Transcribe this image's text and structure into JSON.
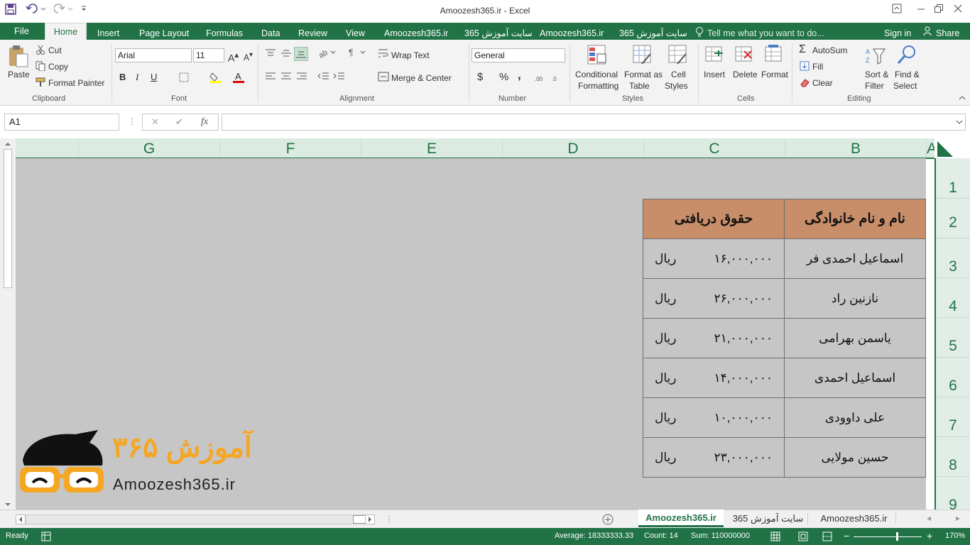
{
  "window": {
    "title": "Amoozesh365.ir - Excel",
    "quick_access": [
      "save-icon",
      "undo-icon",
      "redo-icon",
      "customize-icon"
    ],
    "controls": [
      "ribbon-display-icon",
      "minimize-icon",
      "restore-icon",
      "close-icon"
    ]
  },
  "tabs": {
    "file": "File",
    "home": "Home",
    "insert": "Insert",
    "page_layout": "Page Layout",
    "formulas": "Formulas",
    "data": "Data",
    "review": "Review",
    "view": "View",
    "custom1": "Amoozesh365.ir",
    "custom2": "سایت آموزش 365",
    "custom3": "Amoozesh365.ir",
    "custom4": "سایت آموزش 365",
    "tell_me": "Tell me what you want to do...",
    "sign_in": "Sign in",
    "share": "Share"
  },
  "ribbon": {
    "clipboard": {
      "paste": "Paste",
      "cut": "Cut",
      "copy": "Copy",
      "format_painter": "Format Painter",
      "group": "Clipboard"
    },
    "font": {
      "name": "Arial",
      "size": "11",
      "bold": "B",
      "italic": "I",
      "underline": "U",
      "group": "Font"
    },
    "alignment": {
      "wrap_text": "Wrap Text",
      "merge_center": "Merge & Center",
      "group": "Alignment"
    },
    "number": {
      "format": "General",
      "currency": "$",
      "percent": "%",
      "comma": ",",
      "group": "Number"
    },
    "styles": {
      "conditional": "Conditional",
      "conditional2": "Formatting",
      "format_as": "Format as",
      "table": "Table",
      "cell": "Cell",
      "styles": "Styles",
      "group": "Styles"
    },
    "cells": {
      "insert": "Insert",
      "delete": "Delete",
      "format": "Format",
      "group": "Cells"
    },
    "editing": {
      "autosum": "AutoSum",
      "fill": "Fill",
      "clear": "Clear",
      "sort": "Sort &",
      "filter": "Filter",
      "find": "Find &",
      "select": "Select",
      "group": "Editing"
    }
  },
  "formula_bar": {
    "name_box": "A1",
    "cancel": "✕",
    "enter": "✔",
    "fx": "fx",
    "value": ""
  },
  "columns": [
    "G",
    "F",
    "E",
    "D",
    "C",
    "B",
    "A"
  ],
  "rows": [
    "1",
    "2",
    "3",
    "4",
    "5",
    "6",
    "7",
    "8",
    "9"
  ],
  "table": {
    "header_name": "نام و نام خانوادگی",
    "header_salary": "حقوق دریافتی",
    "currency_label": "ریال",
    "rows": [
      {
        "name": "اسماعیل احمدی فر",
        "salary": "۱۶,۰۰۰,۰۰۰"
      },
      {
        "name": "نازنین راد",
        "salary": "۲۶,۰۰۰,۰۰۰"
      },
      {
        "name": "یاسمن بهرامی",
        "salary": "۲۱,۰۰۰,۰۰۰"
      },
      {
        "name": "اسماعیل احمدی",
        "salary": "۱۴,۰۰۰,۰۰۰"
      },
      {
        "name": "علی داوودی",
        "salary": "۱۰,۰۰۰,۰۰۰"
      },
      {
        "name": "حسین مولایی",
        "salary": "۲۳,۰۰۰,۰۰۰"
      }
    ]
  },
  "logo": {
    "fa": "آموزش ۳۶۵",
    "en": "Amoozesh365.ir"
  },
  "sheets": [
    "Amoozesh365.ir",
    "سایت آموزش 365",
    "Amoozesh365.ir"
  ],
  "status": {
    "ready": "Ready",
    "average": "Average: 18333333.33",
    "count": "Count: 14",
    "sum": "Sum: 110000000",
    "zoom": "170%"
  },
  "colors": {
    "excel_green": "#217346",
    "header_fill": "#c78e69",
    "grid_gray": "#c6c6c6",
    "logo_orange": "#f5a623"
  }
}
